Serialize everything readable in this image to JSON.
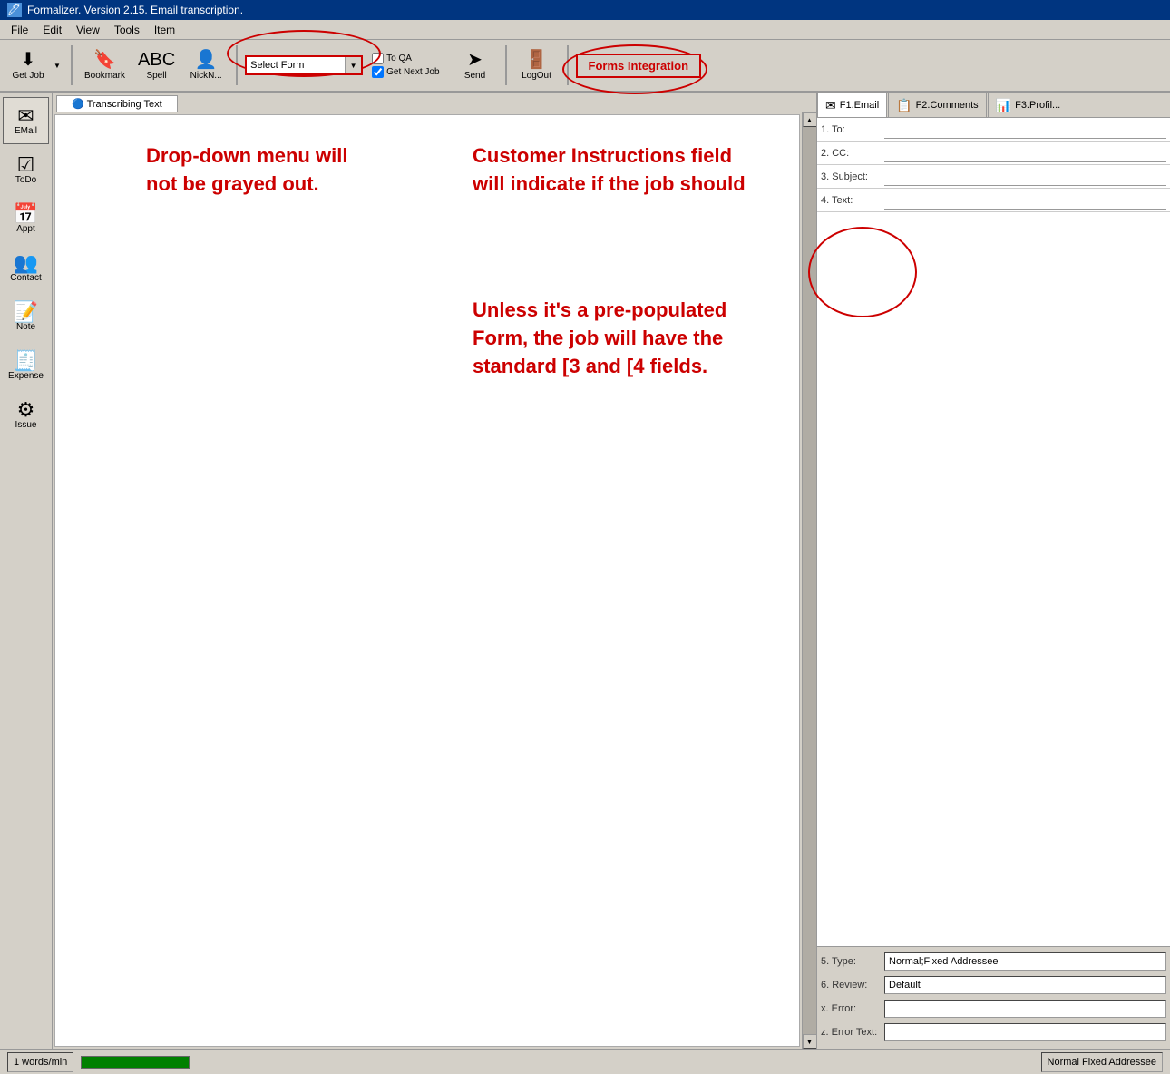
{
  "titlebar": {
    "title": "Formalizer. Version 2.15. Email transcription.",
    "icon": "F"
  },
  "menubar": {
    "items": [
      "File",
      "Edit",
      "View",
      "Tools",
      "Item"
    ]
  },
  "toolbar": {
    "get_job_label": "Get Job",
    "bookmark_label": "Bookmark",
    "spell_label": "Spell",
    "nickname_label": "NickN...",
    "select_form_label": "Select Form",
    "select_form_placeholder": "Select Form",
    "to_qa_label": "To QA",
    "get_next_job_label": "Get Next Job",
    "send_label": "Send",
    "logout_label": "LogOut",
    "forms_integration_label": "Forms Integration"
  },
  "sidebar": {
    "items": [
      {
        "id": "email",
        "label": "EMail",
        "icon": "✉"
      },
      {
        "id": "todo",
        "label": "ToDo",
        "icon": "☑"
      },
      {
        "id": "appt",
        "label": "Appt",
        "icon": "📅"
      },
      {
        "id": "contact",
        "label": "Contact",
        "icon": "👥"
      },
      {
        "id": "note",
        "label": "Note",
        "icon": "📝"
      },
      {
        "id": "expense",
        "label": "Expense",
        "icon": "🧾"
      },
      {
        "id": "issue",
        "label": "Issue",
        "icon": "⚙"
      }
    ]
  },
  "tab": {
    "label": "Transcribing Text"
  },
  "content": {
    "annotation1": "Drop-down menu will\nnot be grayed out.",
    "annotation2": "Customer Instructions field\nwill indicate if the job should",
    "annotation3": "Unless it's a pre-populated\nForm, the job will have the\nstandard [3 and [4 fields."
  },
  "right_panel": {
    "tabs": [
      {
        "id": "email",
        "label": "F1.Email"
      },
      {
        "id": "comments",
        "label": "F2.Comments"
      },
      {
        "id": "profile",
        "label": "F3.Profil..."
      }
    ],
    "fields": [
      {
        "number": "1.",
        "label": "To:",
        "value": ""
      },
      {
        "number": "2.",
        "label": "CC:",
        "value": ""
      },
      {
        "number": "3.",
        "label": "Subject:",
        "value": ""
      },
      {
        "number": "4.",
        "label": "Text:",
        "value": ""
      }
    ],
    "bottom_fields": [
      {
        "number": "5.",
        "label": "Type:",
        "value": "Normal;Fixed Addressee"
      },
      {
        "number": "6.",
        "label": "Review:",
        "value": "Default"
      },
      {
        "number": "x.",
        "label": "Error:",
        "value": ""
      },
      {
        "number": "z.",
        "label": "Error Text:",
        "value": ""
      }
    ]
  },
  "statusbar": {
    "words": "1 words/min",
    "status_text": "Normal Fixed Addressee"
  }
}
